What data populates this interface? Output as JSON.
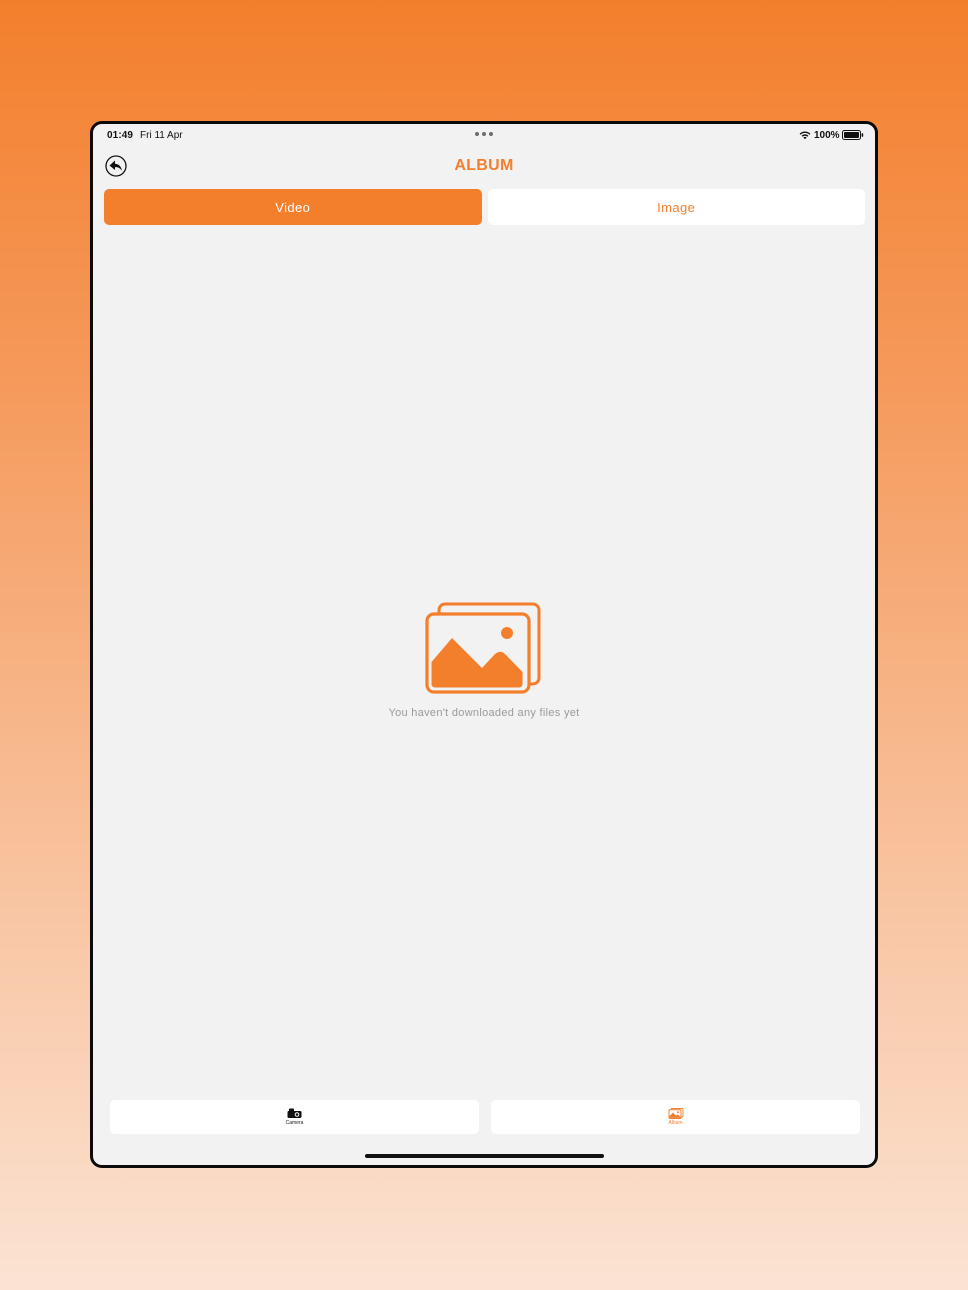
{
  "status_bar": {
    "time": "01:49",
    "date": "Fri 11 Apr",
    "battery": "100%",
    "wifi_icon": "wifi-icon",
    "battery_icon": "battery-icon"
  },
  "header": {
    "back_icon": "back-arrow-icon",
    "title": "ALBUM"
  },
  "tabs": [
    {
      "label": "Video",
      "active": true
    },
    {
      "label": "Image",
      "active": false
    }
  ],
  "empty_state": {
    "icon": "photo-gallery-icon",
    "message": "You haven't downloaded any files yet"
  },
  "tab_bar": [
    {
      "label": "Camera",
      "icon": "camera-icon",
      "active": false
    },
    {
      "label": "Album",
      "icon": "album-icon",
      "active": true
    }
  ],
  "colors": {
    "accent": "#f37f2c",
    "background": "#f2f2f2",
    "muted_text": "#9a9a9a"
  }
}
